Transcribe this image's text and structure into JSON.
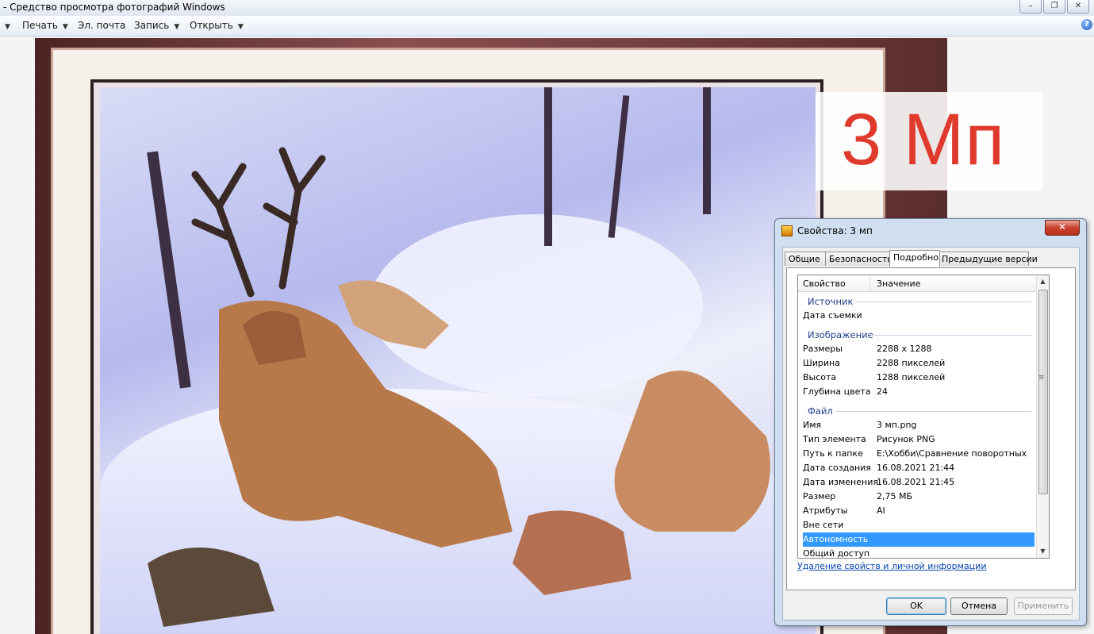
{
  "window": {
    "title": "- Средство просмотра фотографий Windows",
    "minimize_icon": "minimize-icon",
    "maximize_icon": "restore-icon",
    "close_icon": "close-icon"
  },
  "toolbar": {
    "print": "Печать",
    "email": "Эл. почта",
    "burn": "Запись",
    "open": "Открыть",
    "help_glyph": "?"
  },
  "photo": {
    "overlay_text": "3 Мп"
  },
  "dialog": {
    "title": "Свойства: 3 мп",
    "close_glyph": "✕",
    "tabs": [
      "Общие",
      "Безопасность",
      "Подробно",
      "Предыдущие версии"
    ],
    "columns": {
      "property": "Свойство",
      "value": "Значение"
    },
    "groups": {
      "source": "Источник",
      "image": "Изображение",
      "file": "Файл"
    },
    "rows": [
      {
        "key": "Дата съемки",
        "value": ""
      },
      {
        "key": "Размеры",
        "value": "2288 x 1288"
      },
      {
        "key": "Ширина",
        "value": "2288 пикселей"
      },
      {
        "key": "Высота",
        "value": "1288 пикселей"
      },
      {
        "key": "Глубина цвета",
        "value": "24"
      },
      {
        "key": "Имя",
        "value": "3 мп.png"
      },
      {
        "key": "Тип элемента",
        "value": "Рисунок PNG"
      },
      {
        "key": "Путь к папке",
        "value": "E:\\Хобби\\Сравнение поворотных"
      },
      {
        "key": "Дата создания",
        "value": "16.08.2021 21:44"
      },
      {
        "key": "Дата изменения",
        "value": "16.08.2021 21:45"
      },
      {
        "key": "Размер",
        "value": "2,75 МБ"
      },
      {
        "key": "Атрибуты",
        "value": "AI"
      },
      {
        "key": "Вне сети",
        "value": ""
      },
      {
        "key": "Автономность",
        "value": ""
      },
      {
        "key": "Общий доступ",
        "value": ""
      }
    ],
    "selected_row": "Автономность",
    "remove_link": "Удаление свойств и личной информации",
    "buttons": {
      "ok": "OK",
      "cancel": "Отмена",
      "apply": "Применить"
    }
  }
}
